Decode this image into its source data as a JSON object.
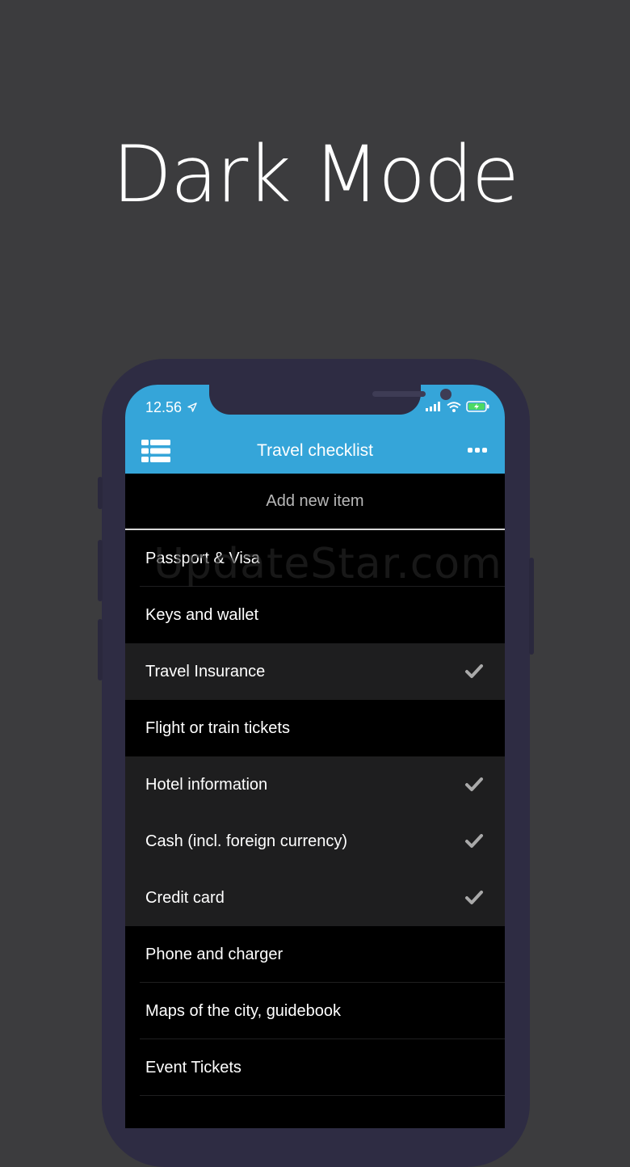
{
  "headline": "Dark Mode",
  "status_bar": {
    "time": "12.56"
  },
  "nav": {
    "title": "Travel checklist"
  },
  "add_item": {
    "placeholder": "Add new item"
  },
  "items": [
    {
      "label": "Passport & Visa",
      "checked": false
    },
    {
      "label": "Keys and wallet",
      "checked": false
    },
    {
      "label": "Travel Insurance",
      "checked": true
    },
    {
      "label": "Flight or train tickets",
      "checked": false
    },
    {
      "label": "Hotel information",
      "checked": true
    },
    {
      "label": "Cash (incl. foreign currency)",
      "checked": true
    },
    {
      "label": "Credit card",
      "checked": true
    },
    {
      "label": "Phone and charger",
      "checked": false
    },
    {
      "label": "Maps of the city, guidebook",
      "checked": false
    },
    {
      "label": "Event Tickets",
      "checked": false
    },
    {
      "label": "",
      "checked": false
    }
  ],
  "watermark": "UpdateStar.com",
  "colors": {
    "accent": "#35a5d9",
    "background": "#3c3c3e",
    "phone_frame": "#2e2c43"
  }
}
